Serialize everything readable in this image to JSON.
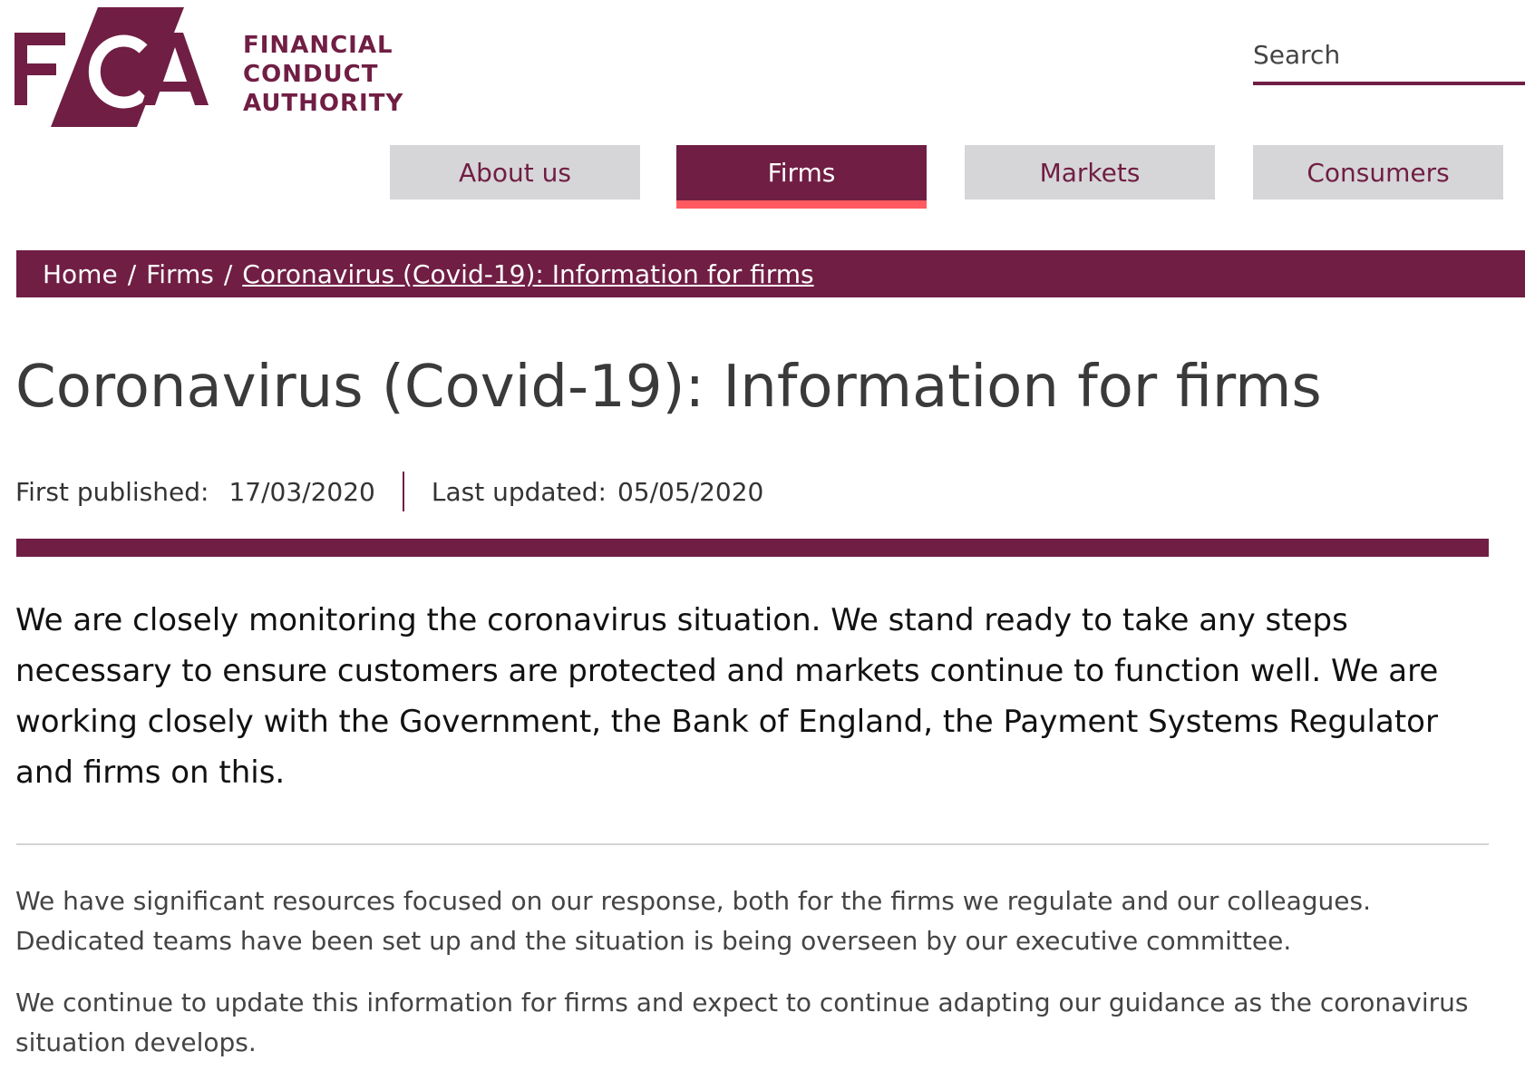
{
  "brand": {
    "monogram": "FCA",
    "name_lines": [
      "FINANCIAL",
      "CONDUCT",
      "AUTHORITY"
    ],
    "primary_color": "#701e44",
    "accent_color": "#ff5a5f"
  },
  "search": {
    "placeholder": "Search"
  },
  "nav": {
    "tabs": [
      {
        "label": "About us",
        "active": false
      },
      {
        "label": "Firms",
        "active": true
      },
      {
        "label": "Markets",
        "active": false
      },
      {
        "label": "Consumers",
        "active": false
      }
    ]
  },
  "breadcrumb": {
    "items": [
      "Home",
      "Firms",
      "Coronavirus (Covid-19): Information for firms"
    ],
    "separator": "/"
  },
  "page": {
    "title": "Coronavirus (Covid-19): Information for firms",
    "first_published_label": "First published:",
    "first_published": "17/03/2020",
    "last_updated_label": "Last updated:",
    "last_updated": "05/05/2020",
    "lead": "We are closely monitoring the coronavirus situation. We stand ready to take any steps necessary to ensure customers are protected and markets continue to function well. We are working closely with the Government, the Bank of England, the Payment Systems Regulator and firms on this.",
    "paragraphs": [
      "We have significant resources focused on our response, both for the firms we regulate and our colleagues. Dedicated teams have been set up and the situation is being overseen by our executive committee.",
      "We continue to update this information for firms and expect to continue adapting our guidance as the coronavirus situation develops."
    ]
  }
}
